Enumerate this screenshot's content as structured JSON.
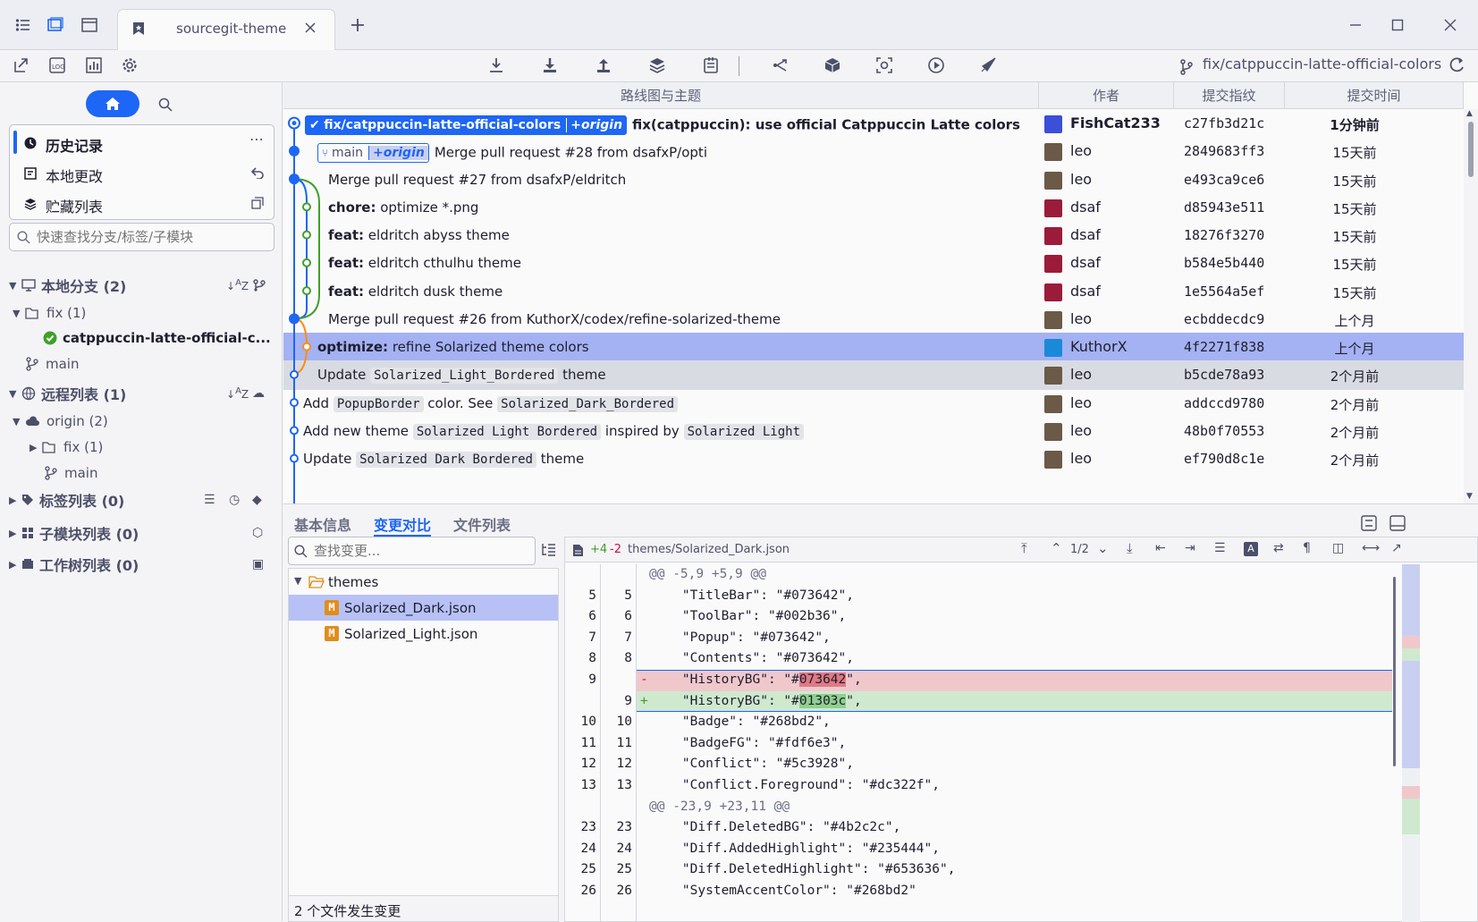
{
  "window": {
    "tab_title": "sourcegit-theme",
    "current_branch": "fix/catppuccin-latte-official-colors"
  },
  "sidebar": {
    "history": "历史记录",
    "local_changes": "本地更改",
    "stashes": "贮藏列表",
    "search_placeholder": "快速查找分支/标签/子模块",
    "local_branches": "本地分支 (2)",
    "fix_folder": "fix (1)",
    "active_branch": "catppuccin-latte-official-c...",
    "main": "main",
    "remotes": "远程列表 (1)",
    "origin": "origin (2)",
    "origin_fix": "fix (1)",
    "origin_main": "main",
    "tags": "标签列表 (0)",
    "submodules": "子模块列表 (0)",
    "worktrees": "工作树列表 (0)"
  },
  "history": {
    "columns": [
      "路线图与主题",
      "作者",
      "提交指纹",
      "提交时间"
    ],
    "commits": [
      {
        "branch": "fix/catppuccin-latte-official-colors",
        "remote": "+origin",
        "prefix": "",
        "subject": "fix(catppuccin): use official Catppuccin Latte colors",
        "author": "FishCat233",
        "sha": "c27fb3d21c",
        "time": "1分钟前"
      },
      {
        "branch": "main",
        "remote": "+origin",
        "prefix": "",
        "subject": "Merge pull request #28 from dsafxP/opti",
        "author": "leo",
        "sha": "2849683ff3",
        "time": "15天前"
      },
      {
        "prefix": "",
        "subject": "Merge pull request #27 from dsafxP/eldritch",
        "author": "leo",
        "sha": "e493ca9ce6",
        "time": "15天前"
      },
      {
        "prefix": "chore:",
        "subject": "optimize *.png",
        "author": "dsaf",
        "sha": "d85943e511",
        "time": "15天前"
      },
      {
        "prefix": "feat:",
        "subject": "eldritch abyss theme",
        "author": "dsaf",
        "sha": "18276f3270",
        "time": "15天前"
      },
      {
        "prefix": "feat:",
        "subject": "eldritch cthulhu theme",
        "author": "dsaf",
        "sha": "b584e5b440",
        "time": "15天前"
      },
      {
        "prefix": "feat:",
        "subject": "eldritch dusk theme",
        "author": "dsaf",
        "sha": "1e5564a5ef",
        "time": "15天前"
      },
      {
        "prefix": "",
        "subject": "Merge pull request #26 from KuthorX/codex/refine-solarized-theme",
        "author": "leo",
        "sha": "ecbddecdc9",
        "time": "上个月"
      },
      {
        "prefix": "optimize:",
        "subject": "refine Solarized theme colors",
        "author": "KuthorX",
        "sha": "4f2271f838",
        "time": "上个月"
      },
      {
        "prefix": "",
        "subject_parts": [
          "Update ",
          "Solarized_Light_Bordered",
          " theme"
        ],
        "author": "leo",
        "sha": "b5cde78a93",
        "time": "2个月前"
      },
      {
        "prefix": "",
        "subject_parts": [
          "Add ",
          "PopupBorder",
          " color. See ",
          "Solarized_Dark_Bordered",
          ""
        ],
        "author": "leo",
        "sha": "addccd9780",
        "time": "2个月前"
      },
      {
        "prefix": "",
        "subject_parts": [
          "Add new theme ",
          "Solarized Light Bordered",
          " inspired by ",
          "Solarized Light",
          ""
        ],
        "author": "leo",
        "sha": "48b0f70553",
        "time": "2个月前"
      },
      {
        "prefix": "",
        "subject_parts": [
          "Update ",
          "Solarized Dark Bordered",
          " theme"
        ],
        "author": "leo",
        "sha": "ef790d8c1e",
        "time": "2个月前"
      }
    ]
  },
  "details": {
    "tabs": [
      "基本信息",
      "变更对比",
      "文件列表"
    ],
    "search_placeholder": "查找变更...",
    "folder": "themes",
    "files": [
      "Solarized_Dark.json",
      "Solarized_Light.json"
    ],
    "file_badge": "M",
    "summary": "2 个文件发生变更",
    "diff_added": "+4",
    "diff_removed": "-2",
    "diff_path": "themes/Solarized_Dark.json",
    "diff_page": "1/2",
    "lines": [
      {
        "k": "hunk",
        "n1": "",
        "n2": "",
        "text": "@@ -5,9 +5,9 @@"
      },
      {
        "k": "ctx",
        "n1": "5",
        "n2": "5",
        "text": "    \"TitleBar\": \"#073642\","
      },
      {
        "k": "ctx",
        "n1": "6",
        "n2": "6",
        "text": "    \"ToolBar\": \"#002b36\","
      },
      {
        "k": "ctx",
        "n1": "7",
        "n2": "7",
        "text": "    \"Popup\": \"#073642\","
      },
      {
        "k": "ctx",
        "n1": "8",
        "n2": "8",
        "text": "    \"Contents\": \"#073642\","
      },
      {
        "k": "del",
        "n1": "9",
        "n2": "",
        "pre": "    \"HistoryBG\": \"#",
        "hl": "073642",
        "post": "\","
      },
      {
        "k": "add",
        "n1": "",
        "n2": "9",
        "pre": "    \"HistoryBG\": \"#",
        "hl": "01303c",
        "post": "\","
      },
      {
        "k": "ctx",
        "n1": "10",
        "n2": "10",
        "text": "    \"Badge\": \"#268bd2\","
      },
      {
        "k": "ctx",
        "n1": "11",
        "n2": "11",
        "text": "    \"BadgeFG\": \"#fdf6e3\","
      },
      {
        "k": "ctx",
        "n1": "12",
        "n2": "12",
        "text": "    \"Conflict\": \"#5c3928\","
      },
      {
        "k": "ctx",
        "n1": "13",
        "n2": "13",
        "text": "    \"Conflict.Foreground\": \"#dc322f\","
      },
      {
        "k": "hunk",
        "n1": "",
        "n2": "",
        "text": "@@ -23,9 +23,11 @@"
      },
      {
        "k": "ctx",
        "n1": "23",
        "n2": "23",
        "text": "    \"Diff.DeletedBG\": \"#4b2c2c\","
      },
      {
        "k": "ctx",
        "n1": "24",
        "n2": "24",
        "text": "    \"Diff.AddedHighlight\": \"#235444\","
      },
      {
        "k": "ctx",
        "n1": "25",
        "n2": "25",
        "text": "    \"Diff.DeletedHighlight\": \"#653636\","
      },
      {
        "k": "ctx",
        "n1": "26",
        "n2": "26",
        "text": "    \"SystemAccentColor\": \"#268bd2\""
      }
    ]
  },
  "colors": {
    "accent": "#1e66f5",
    "selected_row": "#a4b2f3",
    "hover_row": "#d9dbe2",
    "del_bg": "#f0c8cc",
    "add_bg": "#cfe9cf"
  }
}
